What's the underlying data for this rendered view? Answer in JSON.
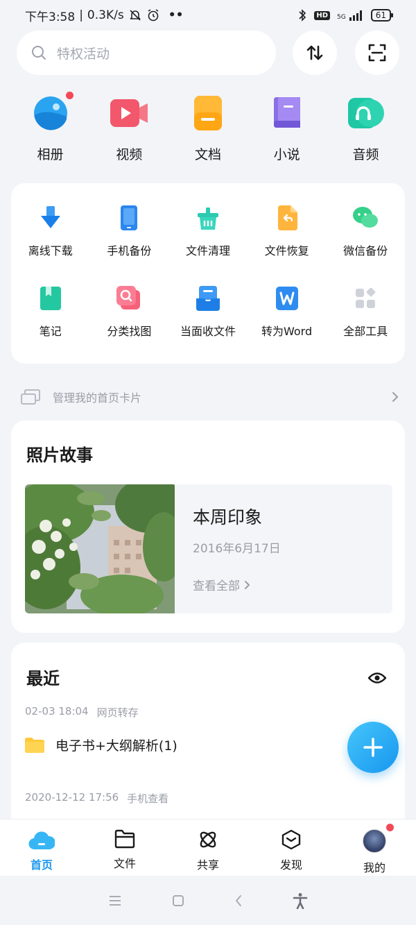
{
  "status_bar": {
    "time": "下午3:58",
    "speed": "0.3K/s",
    "hd": "HD",
    "network": "5G",
    "battery": "61"
  },
  "search": {
    "placeholder": "特权活动"
  },
  "categories": [
    {
      "label": "相册",
      "icon": "album-icon"
    },
    {
      "label": "视频",
      "icon": "video-icon"
    },
    {
      "label": "文档",
      "icon": "document-icon"
    },
    {
      "label": "小说",
      "icon": "novel-icon"
    },
    {
      "label": "音频",
      "icon": "audio-icon"
    }
  ],
  "tools": [
    {
      "label": "离线下载",
      "icon": "offline-download-icon"
    },
    {
      "label": "手机备份",
      "icon": "phone-backup-icon"
    },
    {
      "label": "文件清理",
      "icon": "file-clean-icon"
    },
    {
      "label": "文件恢复",
      "icon": "file-recover-icon"
    },
    {
      "label": "微信备份",
      "icon": "wechat-backup-icon"
    },
    {
      "label": "笔记",
      "icon": "notes-icon"
    },
    {
      "label": "分类找图",
      "icon": "find-image-icon"
    },
    {
      "label": "当面收文件",
      "icon": "receive-file-icon"
    },
    {
      "label": "转为Word",
      "icon": "convert-word-icon"
    },
    {
      "label": "全部工具",
      "icon": "all-tools-icon"
    }
  ],
  "manage": {
    "label": "管理我的首页卡片"
  },
  "photo_story": {
    "title": "照片故事",
    "story_title": "本周印象",
    "story_date": "2016年6月17日",
    "view_all": "查看全部"
  },
  "recent": {
    "title": "最近",
    "items": [
      {
        "time": "02-03 18:04",
        "source": "网页转存",
        "file": "电子书+大纲解析(1)"
      },
      {
        "time": "2020-12-12 17:56",
        "source": "手机查看"
      }
    ]
  },
  "bottom_nav": [
    {
      "label": "首页",
      "active": true
    },
    {
      "label": "文件"
    },
    {
      "label": "共享"
    },
    {
      "label": "发现"
    },
    {
      "label": "我的"
    }
  ],
  "colors": {
    "accent": "#1796ef",
    "background": "#f3f4f8",
    "red_dot": "#f24957"
  }
}
